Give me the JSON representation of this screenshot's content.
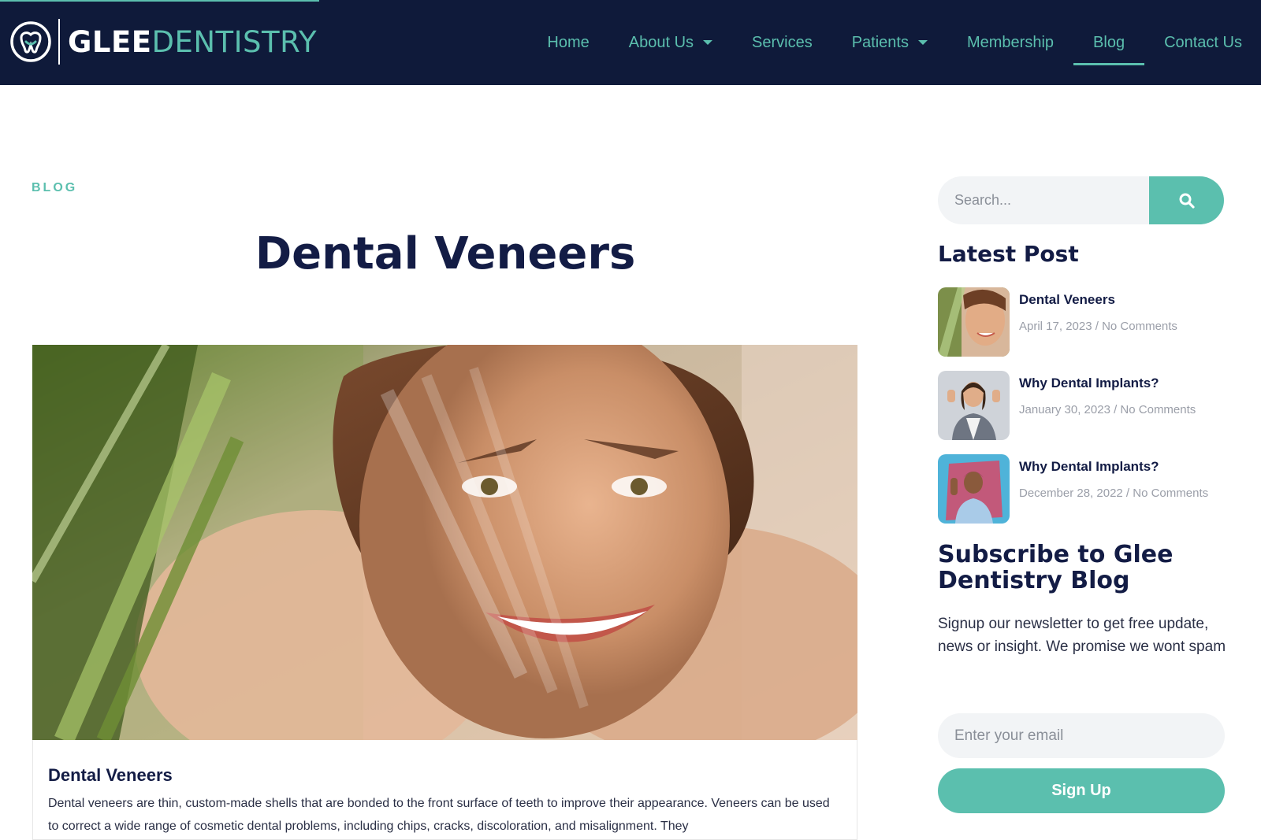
{
  "brand": {
    "name_part1": "GLEE",
    "name_part2": "DENTISTRY",
    "accent_color": "#5bbfae",
    "navy_color": "#0f1a3a"
  },
  "nav": {
    "items": [
      {
        "label": "Home",
        "has_dropdown": false,
        "active": false
      },
      {
        "label": "About Us",
        "has_dropdown": true,
        "active": false
      },
      {
        "label": "Services",
        "has_dropdown": false,
        "active": false
      },
      {
        "label": "Patients",
        "has_dropdown": true,
        "active": false
      },
      {
        "label": "Membership",
        "has_dropdown": false,
        "active": false
      },
      {
        "label": "Blog",
        "has_dropdown": false,
        "active": true
      },
      {
        "label": "Contact Us",
        "has_dropdown": false,
        "active": false
      }
    ]
  },
  "main": {
    "eyebrow": "BLOG",
    "title": "Dental Veneers",
    "card": {
      "title": "Dental Veneers",
      "text": "Dental veneers are thin, custom-made shells that are bonded to the front surface of teeth to improve their appearance. Veneers can be used to correct a wide range of cosmetic dental problems, including chips, cracks, discoloration, and misalignment. They"
    }
  },
  "sidebar": {
    "search": {
      "placeholder": "Search...",
      "icon": "search-icon"
    },
    "latest_heading": "Latest Post",
    "posts": [
      {
        "title": "Dental Veneers",
        "meta": "April 17, 2023 / No Comments"
      },
      {
        "title": "Why Dental Implants?",
        "meta": "January 30, 2023 / No Comments"
      },
      {
        "title": "Why Dental Implants?",
        "meta": "December 28, 2022 / No Comments"
      }
    ],
    "subscribe": {
      "heading": "Subscribe to Glee Dentistry Blog",
      "text": "Signup our newsletter to get free update, news or insight.  We promise we wont spam",
      "email_placeholder": "Enter your email",
      "button_label": "Sign Up"
    }
  }
}
